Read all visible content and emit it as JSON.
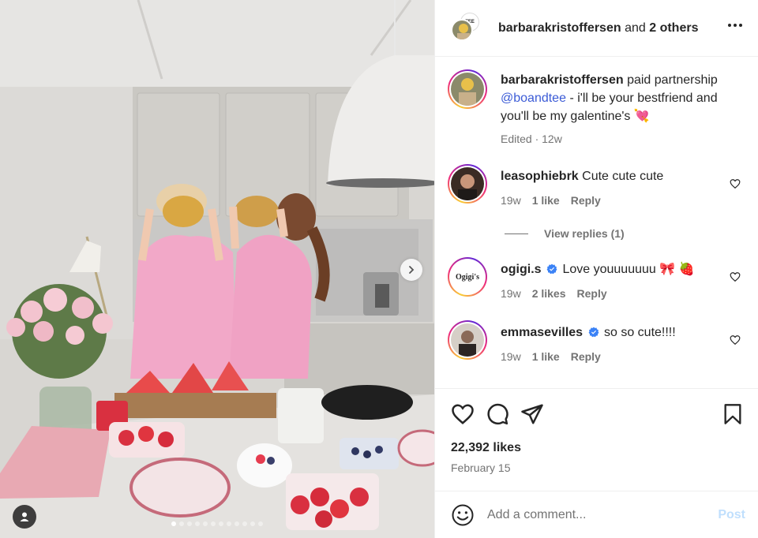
{
  "header": {
    "username": "barbarakristoffersen",
    "and_text": "and",
    "others": "2 others",
    "secondary_avatar_text": "TEE"
  },
  "caption": {
    "username": "barbarakristoffersen",
    "partnership": "paid partnership",
    "mention": "@boandtee",
    "text": "- i'll be your bestfriend and you'll be my galentine's",
    "emoji": "💘",
    "edited": "Edited · 12w"
  },
  "comments": [
    {
      "username": "leasophiebrk",
      "text": "Cute cute cute",
      "age": "19w",
      "likes": "1 like",
      "reply": "Reply",
      "verified": false
    },
    {
      "username": "ogigi.s",
      "text": "Love youuuuuuu 🎀 🍓",
      "age": "19w",
      "likes": "2 likes",
      "reply": "Reply",
      "verified": true,
      "avatar_text": "Ogigi's"
    },
    {
      "username": "emmasevilles",
      "text": "so so cute!!!!",
      "age": "19w",
      "likes": "1 like",
      "reply": "Reply",
      "verified": true
    }
  ],
  "view_replies": "View replies (1)",
  "actions": {
    "likes": "22,392 likes",
    "date": "February 15"
  },
  "composer": {
    "placeholder": "Add a comment...",
    "post_label": "Post"
  },
  "carousel": {
    "total": 12,
    "current": 1
  },
  "colors": {
    "accent": "#0095f6",
    "mention": "#3b5bd6",
    "post_disabled": "#c0dffd",
    "hoodie": "#f2a8c8"
  },
  "icons": [
    "more-icon",
    "heart-icon",
    "comment-icon",
    "share-icon",
    "bookmark-icon",
    "emoji-icon",
    "chevron-right-icon",
    "user-tag-icon",
    "verified-icon"
  ]
}
